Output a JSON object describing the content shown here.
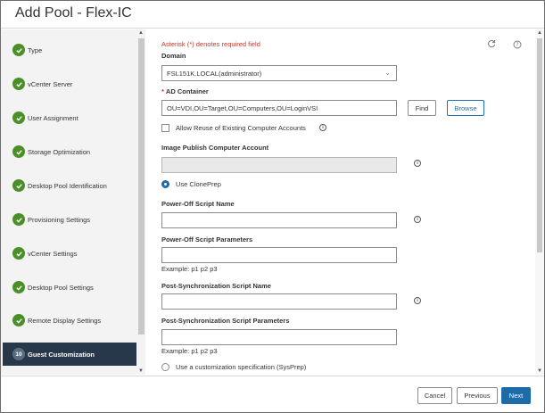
{
  "dialog": {
    "title": "Add Pool - Flex-IC"
  },
  "steps": [
    {
      "label": "Type",
      "status": "complete"
    },
    {
      "label": "vCenter Server",
      "status": "complete"
    },
    {
      "label": "User Assignment",
      "status": "complete"
    },
    {
      "label": "Storage Optimization",
      "status": "complete"
    },
    {
      "label": "Desktop Pool Identification",
      "status": "complete"
    },
    {
      "label": "Provisioning Settings",
      "status": "complete"
    },
    {
      "label": "vCenter Settings",
      "status": "complete"
    },
    {
      "label": "Desktop Pool Settings",
      "status": "complete"
    },
    {
      "label": "Remote Display Settings",
      "status": "complete"
    },
    {
      "label": "Guest Customization",
      "number": "10",
      "status": "active"
    }
  ],
  "form": {
    "required_note": "Asterisk (*) denotes required field",
    "domain_label": "Domain",
    "domain_value": "FSL151K.LOCAL(administrator)",
    "ad_container_label": "AD Container",
    "ad_container_required": "*",
    "ad_container_value": "OU=VDI,OU=Target,OU=Computers,OU=LoginVSI",
    "find_button": "Find",
    "browse_button": "Browse",
    "allow_reuse_label": "Allow Reuse of Existing Computer Accounts",
    "allow_reuse_checked": false,
    "image_publish_label": "Image Publish Computer Account",
    "image_publish_value": "",
    "use_cloneprep_label": "Use ClonePrep",
    "use_cloneprep_selected": true,
    "poweroff_script_name_label": "Power-Off Script Name",
    "poweroff_script_name_value": "",
    "poweroff_script_params_label": "Power-Off Script Parameters",
    "poweroff_script_params_value": "",
    "poweroff_example": "Example: p1 p2 p3",
    "postsync_script_name_label": "Post-Synchronization Script Name",
    "postsync_script_name_value": "",
    "postsync_script_params_label": "Post-Synchronization Script Parameters",
    "postsync_script_params_value": "",
    "postsync_example": "Example: p1 p2 p3",
    "use_sysprep_label": "Use a customization specification (SysPrep)",
    "use_sysprep_selected": false
  },
  "footer": {
    "cancel_label": "Cancel",
    "previous_label": "Previous",
    "next_label": "Next"
  },
  "icons": {
    "step_complete": "check-circle-icon",
    "refresh": "refresh-icon",
    "help": "help-icon",
    "info": "info-icon"
  },
  "colors": {
    "accent": "#1d6ca8",
    "complete": "#4b8f29",
    "active_step_bg": "#26384a",
    "required": "#c0392b"
  }
}
